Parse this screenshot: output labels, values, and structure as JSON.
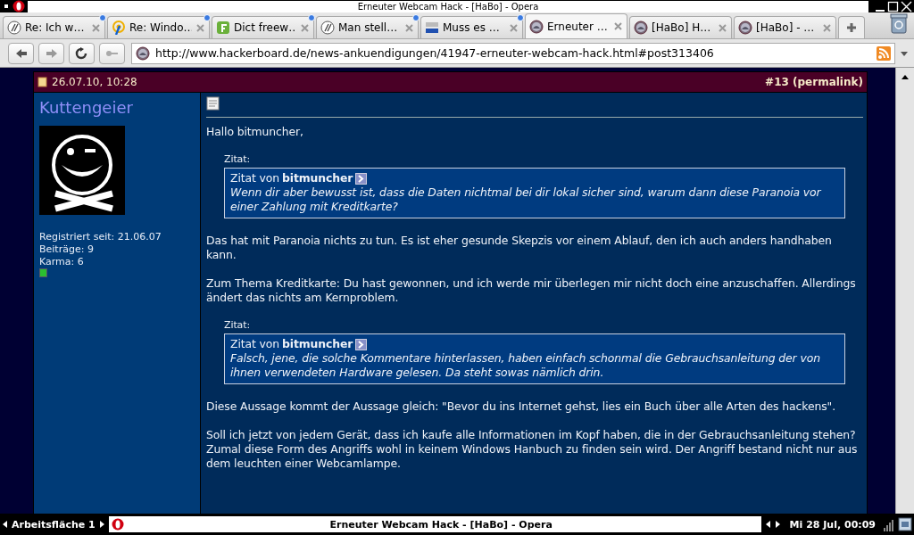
{
  "window": {
    "title": "Erneuter Webcam Hack - [HaBo] - Opera"
  },
  "tabs": [
    {
      "label": "Re: Ich w…",
      "kind": "at",
      "selected": false,
      "unread": true
    },
    {
      "label": "Re: Windo…",
      "kind": "wifi",
      "selected": false,
      "unread": true
    },
    {
      "label": "Dict freew…",
      "kind": "green",
      "selected": false,
      "unread": true
    },
    {
      "label": "Man stell…",
      "kind": "at",
      "selected": false,
      "unread": true
    },
    {
      "label": "Muss es …",
      "kind": "sec",
      "selected": false,
      "unread": true
    },
    {
      "label": "Erneuter …",
      "kind": "habo",
      "selected": true,
      "unread": false
    },
    {
      "label": "[HaBo] H…",
      "kind": "habo",
      "selected": false,
      "unread": false
    },
    {
      "label": "[HaBo] - …",
      "kind": "habo",
      "selected": false,
      "unread": false
    }
  ],
  "address_bar": {
    "url": "http://www.hackerboard.de/news-ankuendigungen/41947-erneuter-webcam-hack.html#post313406"
  },
  "post": {
    "date": "26.07.10, 10:28",
    "post_link": "#13 (permalink)",
    "author": {
      "name": "Kuttengeier",
      "stats": [
        "Registriert seit: 21.06.07",
        "Beiträge: 9",
        "Karma: 6"
      ]
    },
    "blocks": [
      {
        "kind": "text",
        "text": "Hallo bitmuncher,"
      },
      {
        "kind": "quote",
        "label": "Zitat:",
        "by": "Zitat von",
        "author": "bitmuncher",
        "text": "Wenn dir aber bewusst ist, dass die Daten nichtmal bei dir lokal sicher sind, warum dann diese Paranoia vor einer Zahlung mit Kreditkarte?"
      },
      {
        "kind": "text",
        "text": "Das hat mit Paranoia nichts zu tun. Es ist eher gesunde Skepzis vor einem Ablauf, den ich auch anders handhaben kann."
      },
      {
        "kind": "text",
        "text": "Zum Thema Kreditkarte: Du hast gewonnen, und ich werde mir überlegen mir nicht doch eine anzuschaffen. Allerdings ändert das nichts am Kernproblem."
      },
      {
        "kind": "quote",
        "label": "Zitat:",
        "by": "Zitat von",
        "author": "bitmuncher",
        "text": "Falsch, jene, die solche Kommentare hinterlassen, haben einfach schonmal die Gebrauchsanleitung der von ihnen verwendeten Hardware gelesen. Da steht sowas nämlich drin."
      },
      {
        "kind": "text",
        "text": "Diese Aussage kommt der Aussage gleich: \"Bevor du ins Internet gehst, lies ein Buch über alle Arten des hackens\"."
      },
      {
        "kind": "text",
        "text": "Soll ich jetzt von jedem Gerät, dass ich kaufe alle Informationen im Kopf haben, die in der Gebrauchsanleitung stehen? Zumal diese Form des Angriffs wohl in keinem Windows Hanbuch zu finden sein wird. Der Angriff bestand nicht nur aus dem leuchten einer Webcamlampe."
      }
    ]
  },
  "taskbar": {
    "workspace": "Arbeitsfläche 1",
    "task": "Erneuter Webcam Hack - [HaBo] - Opera",
    "clock": "Mi 28 Jul, 00:09"
  }
}
